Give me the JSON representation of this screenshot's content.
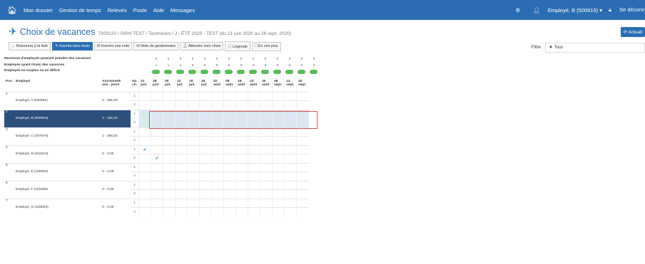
{
  "topbar": {
    "nav": [
      "Mon dossier",
      "Gestion de temps",
      "Relevés",
      "Poste",
      "Aide",
      "Messages"
    ],
    "user": "Employé, B (500916)",
    "logout": "Se déconn",
    "colors": {
      "bar": "#2a6db3"
    }
  },
  "page": {
    "title": "Choix de vacances",
    "subtitle": "7303120 / SIRH TEST / Technicien / J - ÉTÉ 2020 - TEST (du 21 juin 2020 au 26 sept. 2020)",
    "actualize": "Actuali"
  },
  "toolbar": {
    "back": "Retourner à la liste",
    "inscrire": "Inscrire mes choix",
    "note": "Inscrire une note",
    "note_gest": "Note du gestionnaire",
    "attendre": "Attendre mes choix",
    "legende": "Légende",
    "en_voir": "En voir plus"
  },
  "filter": {
    "label": "Filtre",
    "value": "Tous"
  },
  "summary": {
    "row1": "Maximum d'employés pouvant prendre des vacances",
    "row2": "Employés ayant choisi des vacances",
    "row3": "Employés en surplus ou en déficit",
    "max_counts": [
      "0",
      "0",
      "0",
      "0",
      "0",
      "0",
      "0",
      "0",
      "0",
      "0",
      "0",
      "0",
      "0",
      "0"
    ],
    "chosen_counts": [
      "1",
      "1",
      "1",
      "0",
      "0",
      "0",
      "0",
      "0",
      "0",
      "0",
      "0",
      "0",
      "0",
      "0"
    ]
  },
  "grid": {
    "headers": {
      "pos": "Pos.",
      "emp": "Employé",
      "anc1": "Ancienneté",
      "anc2": "ans - jours",
      "no1": "No",
      "no2": "ch."
    },
    "weeks": [
      {
        "d": "21",
        "m": "juin"
      },
      {
        "d": "28",
        "m": "juin"
      },
      {
        "d": "05",
        "m": "juil."
      },
      {
        "d": "12",
        "m": "juil."
      },
      {
        "d": "19",
        "m": "juil."
      },
      {
        "d": "26",
        "m": "juil."
      },
      {
        "d": "02",
        "m": "août"
      },
      {
        "d": "09",
        "m": "août"
      },
      {
        "d": "16",
        "m": "août"
      },
      {
        "d": "23",
        "m": "août"
      },
      {
        "d": "30",
        "m": "août"
      },
      {
        "d": "06",
        "m": "sept."
      },
      {
        "d": "13",
        "m": "sept."
      },
      {
        "d": "20",
        "m": "sept."
      }
    ],
    "rows": [
      {
        "pos": "1",
        "emp": "Employé, A (030091)",
        "anc": "2 - 301,00"
      },
      {
        "pos": "2",
        "emp": "Employé, B (500916)",
        "anc": "2 - 102,20"
      },
      {
        "pos": "3",
        "emp": "Employé, C (037579)",
        "anc": "1 - 355,00"
      },
      {
        "pos": "4",
        "emp": "Employé, D (042413)",
        "anc": "0 - 0,00"
      },
      {
        "pos": "5",
        "emp": "Employé, E (100000)",
        "anc": "0 - 0,00"
      },
      {
        "pos": "6",
        "emp": "Employé, F (101000)",
        "anc": "0 - 0,00"
      },
      {
        "pos": "7",
        "emp": "Employé, G (100003)",
        "anc": "0 - 0,00"
      }
    ],
    "choice_nums": [
      "1",
      "2"
    ],
    "checks": "✔"
  }
}
